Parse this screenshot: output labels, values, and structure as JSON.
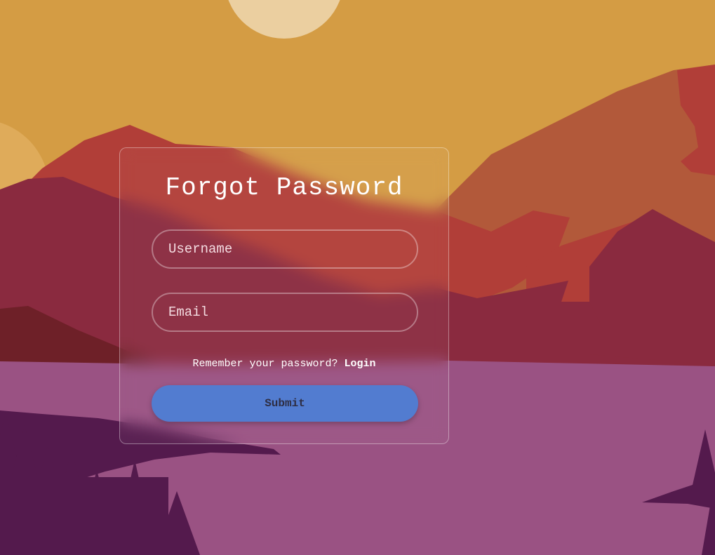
{
  "form": {
    "title": "Forgot Password",
    "username_placeholder": "Username",
    "email_placeholder": "Email",
    "remember_text": "Remember your password?",
    "login_link": "Login",
    "submit_label": "Submit"
  },
  "colors": {
    "sky": "#d49c44",
    "sun": "#ebcfa0",
    "mountain_orange": "#b2593a",
    "mountain_red": "#b13e38",
    "mountain_maroon": "#8a2a3f",
    "lake": "#9a5283",
    "trees": "#541a4d",
    "submit_button": "#527cd0"
  }
}
